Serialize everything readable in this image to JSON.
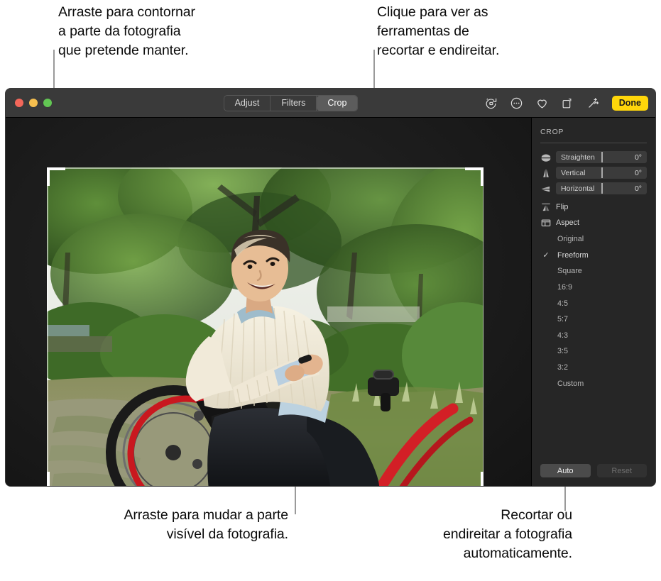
{
  "callouts": {
    "top_left": "Arraste para contornar\na parte da fotografia\nque pretende manter.",
    "top_right": "Clique para ver as\nferramentas de\nrecortar e endireitar.",
    "bottom_left": "Arraste para mudar a parte\nvisível da fotografia.",
    "bottom_right": "Recortar ou\nendireitar a fotografia\nautomaticamente."
  },
  "window": {
    "titlebar": {
      "segments": [
        {
          "label": "Adjust",
          "active": false
        },
        {
          "label": "Filters",
          "active": false
        },
        {
          "label": "Crop",
          "active": true
        }
      ],
      "tools": [
        {
          "name": "rotate-counterclockwise-icon"
        },
        {
          "name": "more-options-icon"
        },
        {
          "name": "heart-icon"
        },
        {
          "name": "compare-icon"
        },
        {
          "name": "enhance-magic-wand-icon"
        }
      ],
      "done_label": "Done",
      "done_color": "#ffd60a"
    },
    "sidebar": {
      "title": "CROP",
      "sliders": [
        {
          "icon": "straighten-icon",
          "label": "Straighten",
          "value": "0°"
        },
        {
          "icon": "vertical-perspective-icon",
          "label": "Vertical",
          "value": "0°"
        },
        {
          "icon": "horizontal-perspective-icon",
          "label": "Horizontal",
          "value": "0°"
        }
      ],
      "options": [
        {
          "icon": "flip-icon",
          "label": "Flip"
        },
        {
          "icon": "aspect-icon",
          "label": "Aspect"
        }
      ],
      "aspects": [
        {
          "label": "Original",
          "selected": false
        },
        {
          "label": "Freeform",
          "selected": true
        },
        {
          "label": "Square",
          "selected": false
        },
        {
          "label": "16:9",
          "selected": false
        },
        {
          "label": "4:5",
          "selected": false
        },
        {
          "label": "5:7",
          "selected": false
        },
        {
          "label": "4:3",
          "selected": false
        },
        {
          "label": "3:5",
          "selected": false
        },
        {
          "label": "3:2",
          "selected": false
        },
        {
          "label": "Custom",
          "selected": false
        }
      ],
      "auto_label": "Auto",
      "reset_label": "Reset"
    },
    "photo": {
      "alt": "Smiling man in a red-framed wheelchair in a green garden, looking up"
    }
  }
}
